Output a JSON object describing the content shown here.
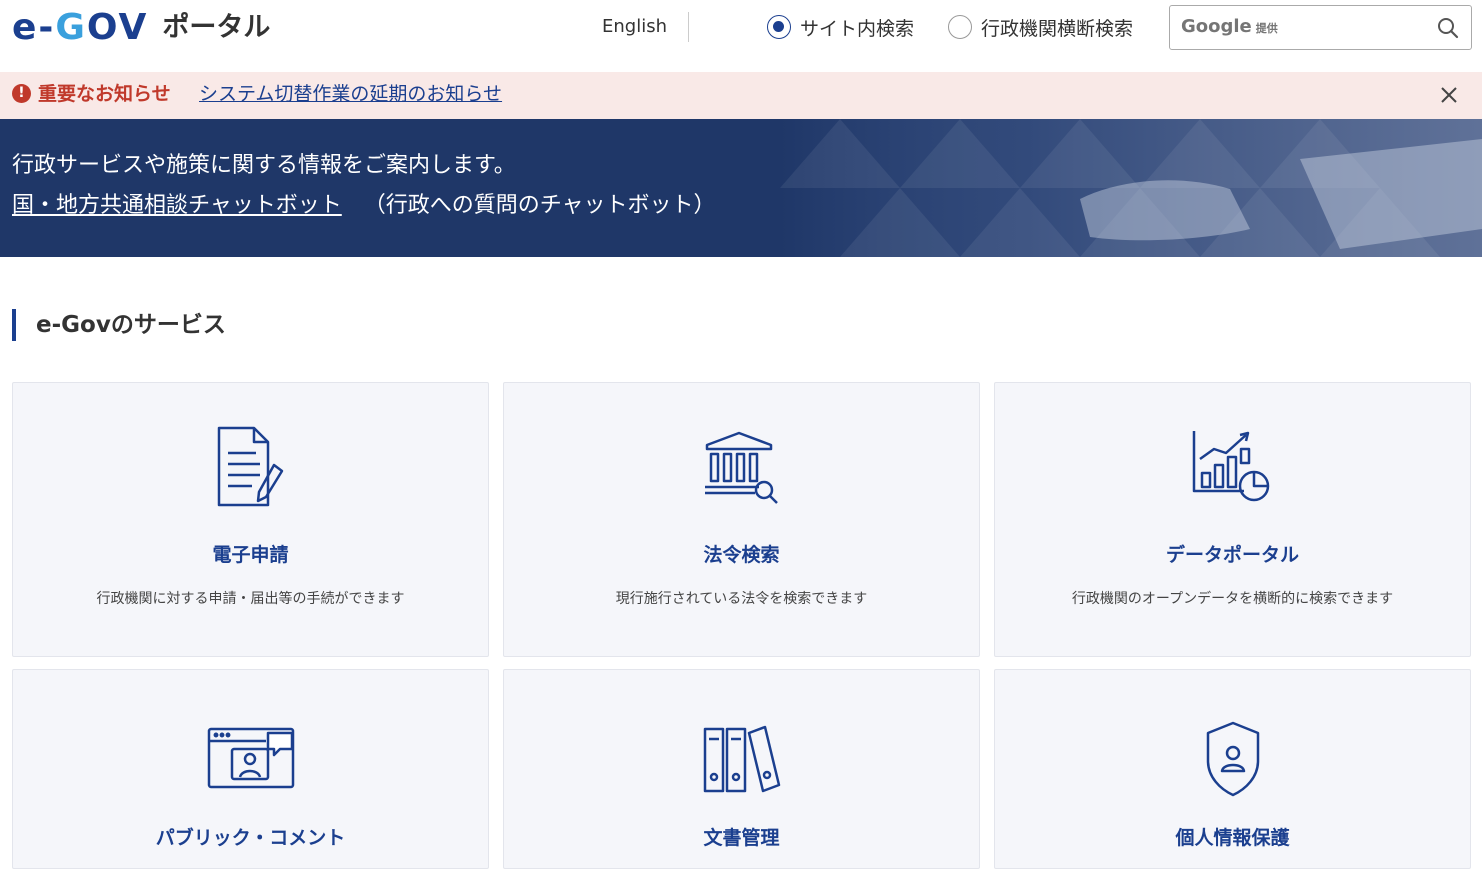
{
  "header": {
    "logo_text_e": "e-",
    "logo_text_g": "G",
    "logo_text_ov": "OV",
    "logo_sub": "ポータル",
    "language_link": "English",
    "search_options": [
      {
        "label": "サイト内検索",
        "selected": true
      },
      {
        "label": "行政機関横断検索",
        "selected": false
      }
    ],
    "search": {
      "brand": "Google",
      "brand_suffix": "提供",
      "placeholder": "",
      "value": ""
    }
  },
  "notice": {
    "title": "重要なお知らせ",
    "link_text": "システム切替作業の延期のお知らせ"
  },
  "hero": {
    "line1": "行政サービスや施策に関する情報をご案内します。",
    "chatbot_link": "国・地方共通相談チャットボット",
    "chatbot_note": "（行政への質問のチャットボット）"
  },
  "services_section": {
    "title": "e-Govのサービス",
    "cards": [
      {
        "icon": "document-pen-icon",
        "title": "電子申請",
        "description": "行政機関に対する申請・届出等の手続ができます"
      },
      {
        "icon": "law-building-search-icon",
        "title": "法令検索",
        "description": "現行施行されている法令を検索できます"
      },
      {
        "icon": "chart-data-icon",
        "title": "データポータル",
        "description": "行政機関のオープンデータを横断的に検索できます"
      },
      {
        "icon": "public-comment-icon",
        "title": "パブリック・コメント",
        "description": ""
      },
      {
        "icon": "binders-icon",
        "title": "文書管理",
        "description": ""
      },
      {
        "icon": "shield-person-icon",
        "title": "個人情報保護",
        "description": ""
      }
    ]
  },
  "colors": {
    "brand_navy": "#1b3f8f",
    "brand_light_blue": "#3aa0dd",
    "hero_bg": "#1f3768",
    "notice_bg": "#f9e9e7",
    "notice_red": "#c0392b",
    "card_bg": "#f5f6fa"
  }
}
